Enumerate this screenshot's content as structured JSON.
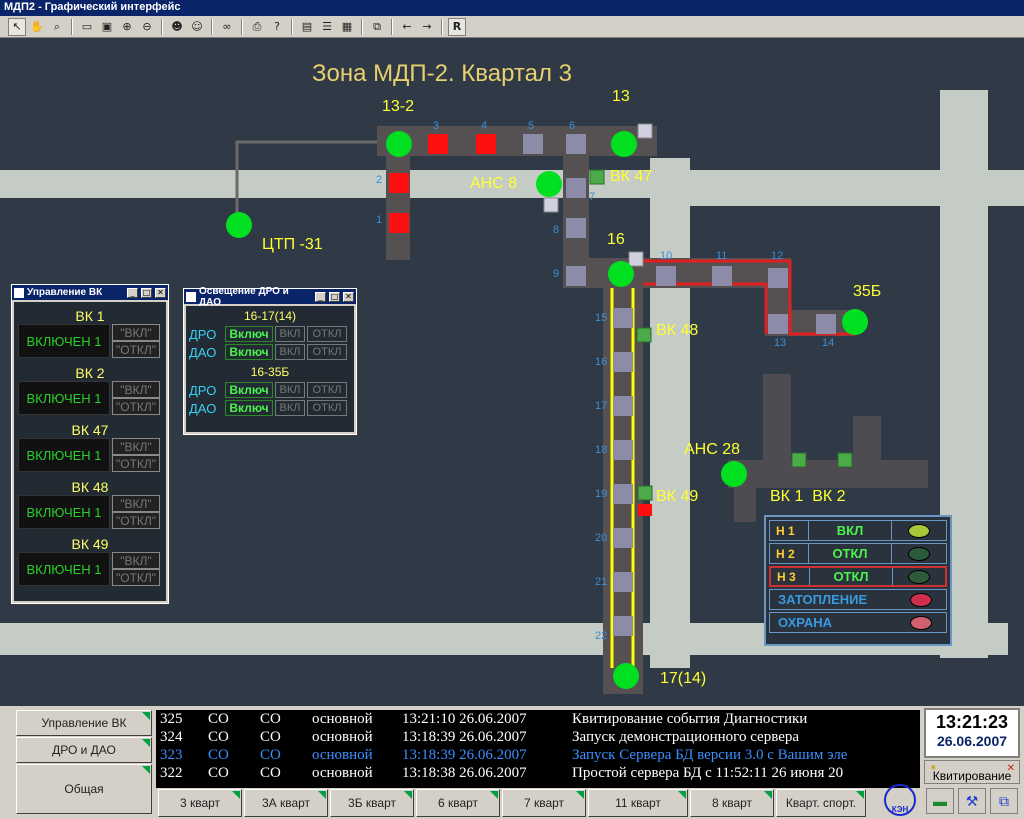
{
  "window": {
    "title": "МДП2 - Графический интерфейс"
  },
  "toolbar": {
    "right_button_label": "R"
  },
  "map": {
    "title": "Зона МДП-2. Квартал 3",
    "nodes": {
      "n13_2": "13-2",
      "n13": "13",
      "n16": "16",
      "n35b": "35Б",
      "n17_14": "17(14)",
      "ctp": "ЦТП -31",
      "ans8": "АНС 8",
      "ans28": "АНС 28"
    },
    "valves": {
      "vk47": "ВК 47",
      "vk48": "ВК 48",
      "vk49": "ВК 49",
      "vk1vk2": "ВК 1  ВК 2"
    },
    "segment_numbers": [
      "1",
      "2",
      "3",
      "4",
      "5",
      "6",
      "7",
      "8",
      "9",
      "10",
      "11",
      "12",
      "13",
      "14",
      "15",
      "16",
      "17",
      "18",
      "19",
      "20",
      "21",
      "22"
    ]
  },
  "vk_dialog": {
    "title": "Управление ВК",
    "items": [
      {
        "name": "ВК 1",
        "status": "ВКЛЮЧЕН 1",
        "on": "\"ВКЛ\"",
        "off": "\"ОТКЛ\""
      },
      {
        "name": "ВК 2",
        "status": "ВКЛЮЧЕН 1",
        "on": "\"ВКЛ\"",
        "off": "\"ОТКЛ\""
      },
      {
        "name": "ВК 47",
        "status": "ВКЛЮЧЕН 1",
        "on": "\"ВКЛ\"",
        "off": "\"ОТКЛ\""
      },
      {
        "name": "ВК 48",
        "status": "ВКЛЮЧЕН 1",
        "on": "\"ВКЛ\"",
        "off": "\"ОТКЛ\""
      },
      {
        "name": "ВК 49",
        "status": "ВКЛЮЧЕН 1",
        "on": "\"ВКЛ\"",
        "off": "\"ОТКЛ\""
      }
    ]
  },
  "dro_dialog": {
    "title": "Освещение ДРО и ДАО",
    "groups": [
      {
        "header": "16-17(14)",
        "rows": [
          {
            "label": "ДРО",
            "state": "Включ",
            "on": "ВКЛ",
            "off": "ОТКЛ"
          },
          {
            "label": "ДАО",
            "state": "Включ",
            "on": "ВКЛ",
            "off": "ОТКЛ"
          }
        ]
      },
      {
        "header": "16-35Б",
        "rows": [
          {
            "label": "ДРО",
            "state": "Включ",
            "on": "ВКЛ",
            "off": "ОТКЛ"
          },
          {
            "label": "ДАО",
            "state": "Включ",
            "on": "ВКЛ",
            "off": "ОТКЛ"
          }
        ]
      }
    ]
  },
  "status_panel": {
    "rows": [
      {
        "label": "Н 1",
        "state": "ВКЛ",
        "led": "#a8c83a"
      },
      {
        "label": "Н 2",
        "state": "ОТКЛ",
        "led": "#2e5a3c"
      },
      {
        "label": "Н 3",
        "state": "ОТКЛ",
        "led": "#2e5a3c"
      }
    ],
    "flood": {
      "label": "ЗАТОПЛЕНИЕ",
      "led": "#d03050"
    },
    "guard": {
      "label": "ОХРАНА",
      "led": "#d06070"
    }
  },
  "bottom": {
    "side_buttons": [
      "Управление ВК",
      "ДРО и ДАО",
      "Общая"
    ],
    "log": [
      {
        "id": "325",
        "a": "СО",
        "b": "СО",
        "type": "основной",
        "time": "13:21:10 26.06.2007",
        "msg": "Квитирование события Диагностики",
        "color": "#ffffff"
      },
      {
        "id": "324",
        "a": "СО",
        "b": "СО",
        "type": "основной",
        "time": "13:18:39 26.06.2007",
        "msg": "Запуск демонстрационного сервера",
        "color": "#ffffff"
      },
      {
        "id": "323",
        "a": "СО",
        "b": "СО",
        "type": "основной",
        "time": "13:18:39 26.06.2007",
        "msg": "Запуск Сервера БД версии 3.0 с Вашим эле",
        "color": "#3b8fff"
      },
      {
        "id": "322",
        "a": "СО",
        "b": "СО",
        "type": "основной",
        "time": "13:18:38 26.06.2007",
        "msg": "Простой сервера БД с 11:52:11  26 июня 20",
        "color": "#ffffff"
      }
    ],
    "quarter_buttons": [
      "3 кварт",
      "3А кварт",
      "3Б кварт",
      "6 кварт",
      "7 кварт",
      "11 кварт",
      "8 кварт",
      "Кварт. спорт."
    ],
    "logo_text": "КЭН",
    "clock": {
      "time": "13:21:23",
      "date": "26.06.2007"
    },
    "ack_label": "Квитирование"
  }
}
